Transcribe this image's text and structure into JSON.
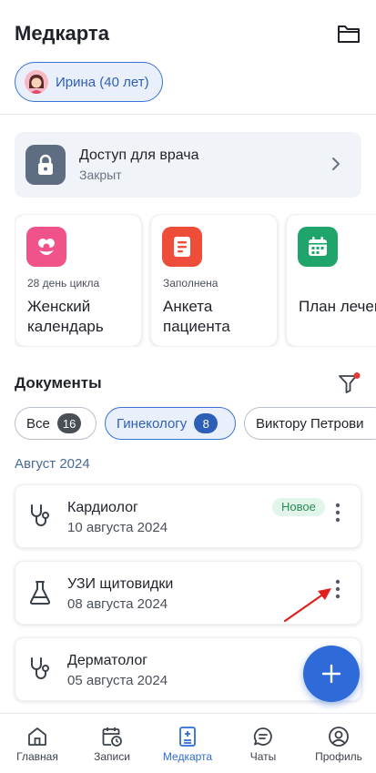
{
  "header": {
    "title": "Медкарта",
    "patient": "Ирина (40 лет)"
  },
  "access": {
    "title": "Доступ для врача",
    "status": "Закрыт"
  },
  "cards": [
    {
      "subtitle": "28 день цикла",
      "title": "Женский календарь",
      "color": "#f0538a",
      "icon": "flower-icon"
    },
    {
      "subtitle": "Заполнена",
      "title": "Анкета пациента",
      "color": "#ee4d3a",
      "icon": "document-icon"
    },
    {
      "subtitle": "",
      "title": "План лечения",
      "color": "#1fa56b",
      "icon": "calendar-icon"
    }
  ],
  "documents": {
    "title": "Документы",
    "chips": [
      {
        "label": "Все",
        "count": "16"
      },
      {
        "label": "Гинекологу",
        "count": "8"
      },
      {
        "label": "Виктору Петрови"
      }
    ],
    "month": "Август 2024",
    "items": [
      {
        "title": "Кардиолог",
        "date": "10 августа 2024",
        "badge": "Новое",
        "icon": "stethoscope-icon"
      },
      {
        "title": "УЗИ щитовидки",
        "date": "08 августа 2024",
        "icon": "flask-icon"
      },
      {
        "title": "Дерматолог",
        "date": "05 августа 2024",
        "icon": "stethoscope-icon"
      }
    ]
  },
  "tabs": [
    {
      "label": "Главная",
      "icon": "home-icon"
    },
    {
      "label": "Записи",
      "icon": "calendar-clock-icon"
    },
    {
      "label": "Медкарта",
      "icon": "medcard-icon",
      "active": true
    },
    {
      "label": "Чаты",
      "icon": "chat-icon"
    },
    {
      "label": "Профиль",
      "icon": "profile-icon"
    }
  ],
  "colors": {
    "accent": "#2f6ad9",
    "new_badge": "#2d8a57",
    "annotation_arrow": "#e0201c"
  }
}
